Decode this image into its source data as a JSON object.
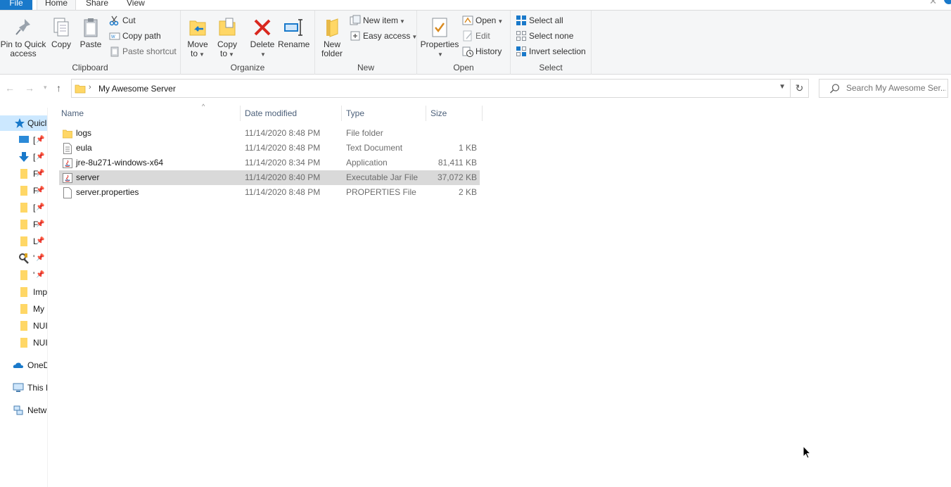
{
  "tabs": {
    "file": "File",
    "home": "Home",
    "share": "Share",
    "view": "View"
  },
  "ribbon": {
    "clipboard": {
      "label": "Clipboard",
      "pin_line1": "Pin to Quick",
      "pin_line2": "access",
      "copy": "Copy",
      "paste": "Paste",
      "cut": "Cut",
      "copy_path": "Copy path",
      "paste_shortcut": "Paste shortcut"
    },
    "organize": {
      "label": "Organize",
      "move_line1": "Move",
      "move_line2": "to",
      "copy_line1": "Copy",
      "copy_line2": "to",
      "delete": "Delete",
      "rename": "Rename"
    },
    "new": {
      "label": "New",
      "folder_line1": "New",
      "folder_line2": "folder",
      "new_item": "New item",
      "easy_access": "Easy access"
    },
    "open": {
      "label": "Open",
      "properties": "Properties",
      "open": "Open",
      "edit": "Edit",
      "history": "History"
    },
    "select": {
      "label": "Select",
      "select_all": "Select all",
      "select_none": "Select none",
      "invert": "Invert selection"
    }
  },
  "address": {
    "path": "My Awesome Server"
  },
  "search": {
    "placeholder": "Search My Awesome Ser..."
  },
  "navpane": {
    "quick": "Quicl",
    "items": [
      "[",
      "[",
      "F",
      "F",
      "[",
      "F",
      "L",
      "'",
      "'"
    ],
    "folders": [
      "Imp",
      "My",
      "NUI",
      "NUI"
    ],
    "onedrive": "OneD",
    "thispc": "This F",
    "network": "Netw"
  },
  "columns": {
    "name": "Name",
    "date": "Date modified",
    "type": "Type",
    "size": "Size"
  },
  "files": [
    {
      "name": "logs",
      "date": "11/14/2020 8:48 PM",
      "type": "File folder",
      "size": "",
      "icon": "folder-icon"
    },
    {
      "name": "eula",
      "date": "11/14/2020 8:48 PM",
      "type": "Text Document",
      "size": "1 KB",
      "icon": "text-file-icon"
    },
    {
      "name": "jre-8u271-windows-x64",
      "date": "11/14/2020 8:34 PM",
      "type": "Application",
      "size": "81,411 KB",
      "icon": "java-app-icon"
    },
    {
      "name": "server",
      "date": "11/14/2020 8:40 PM",
      "type": "Executable Jar File",
      "size": "37,072 KB",
      "icon": "jar-file-icon"
    },
    {
      "name": "server.properties",
      "date": "11/14/2020 8:48 PM",
      "type": "PROPERTIES File",
      "size": "2 KB",
      "icon": "blank-file-icon"
    }
  ],
  "colors": {
    "accent": "#1979ca",
    "folder": "#ffd766",
    "selected_row": "#d9d9d9",
    "delete_red": "#d9281f"
  }
}
